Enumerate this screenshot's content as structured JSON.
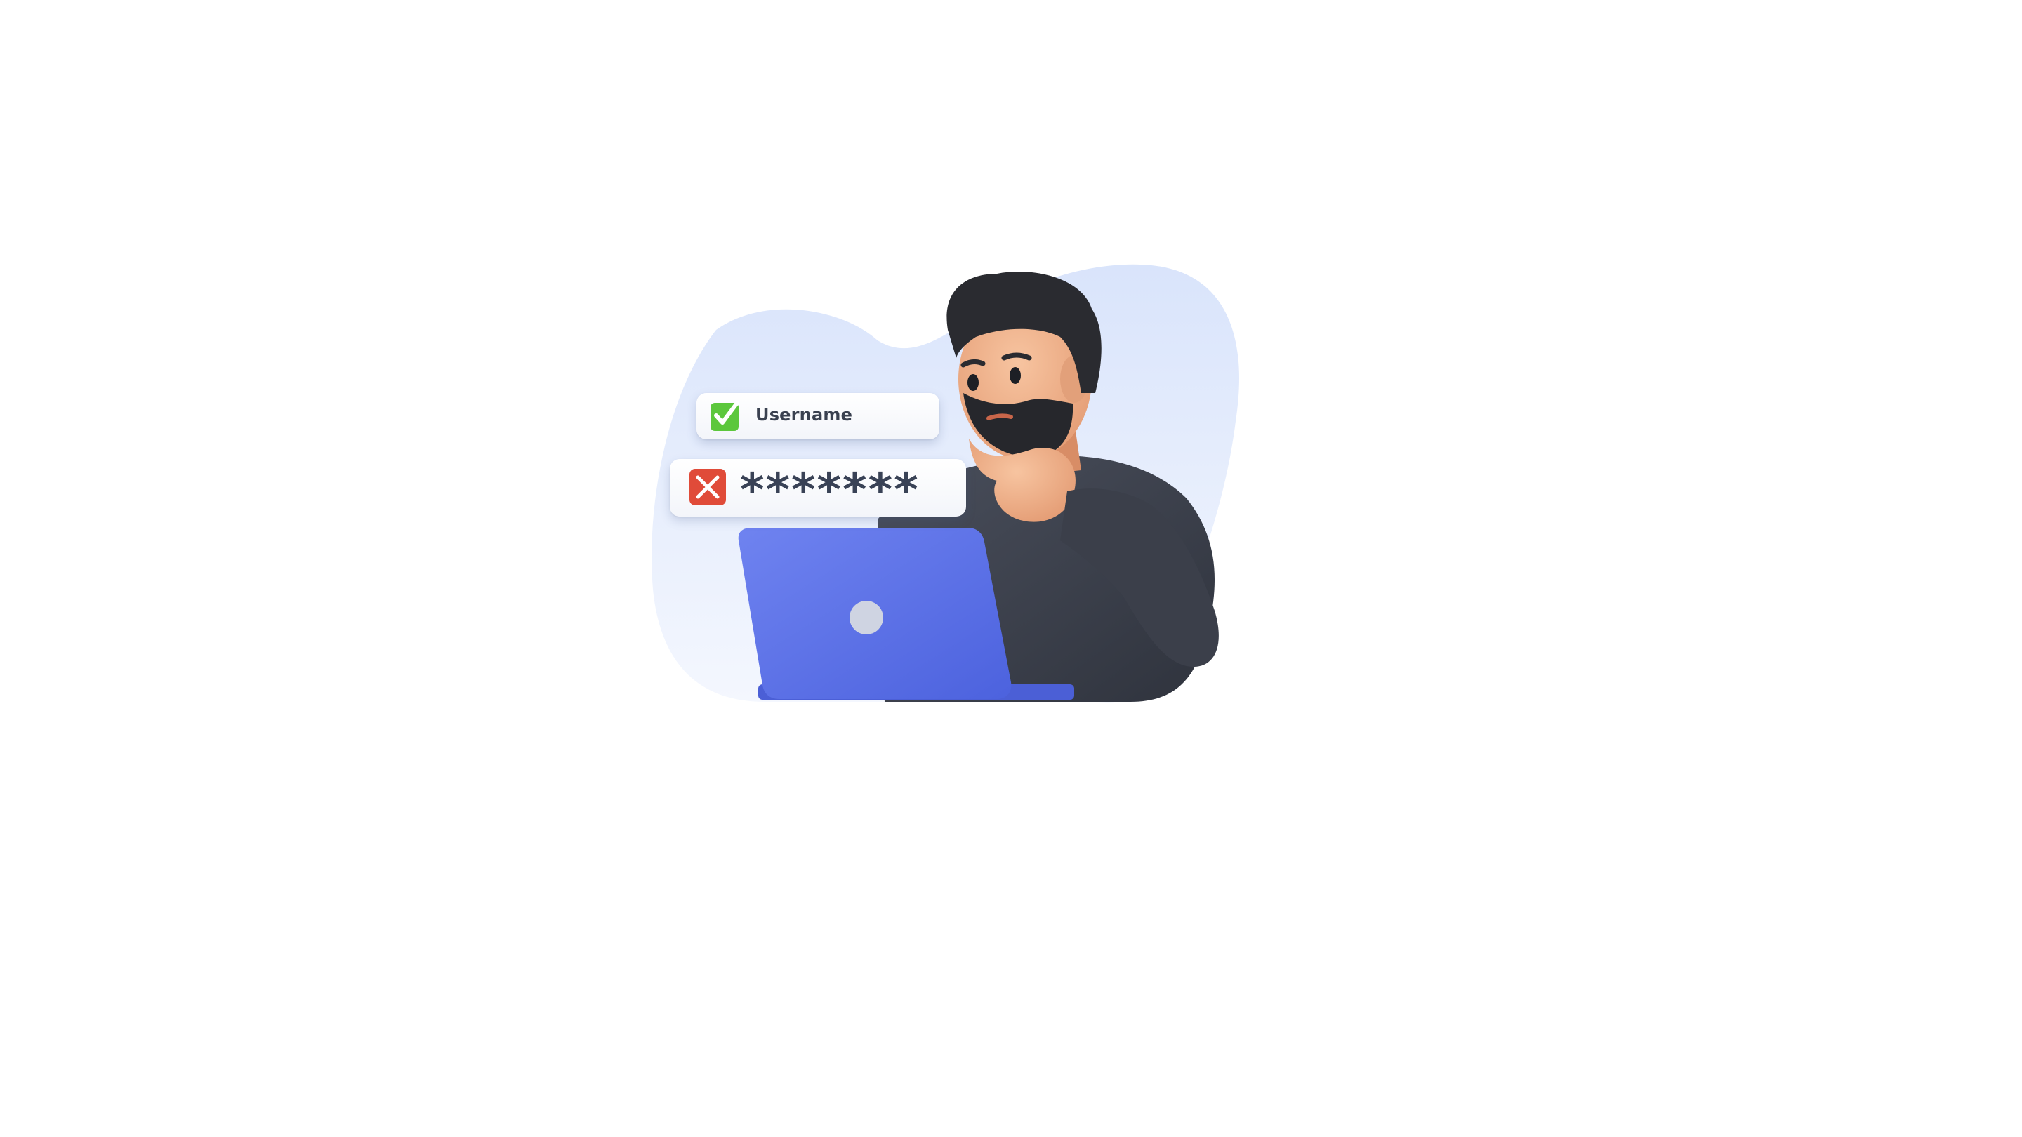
{
  "login_illustration": {
    "username_field": {
      "label": "Username",
      "status_icon": "check-icon",
      "status_color": "#5cc73c"
    },
    "password_field": {
      "masked_value": "*******",
      "status_icon": "x-icon",
      "status_color": "#e04b39"
    },
    "laptop_color": "#5a6fe6",
    "blob_color": "#dfe8fb"
  }
}
